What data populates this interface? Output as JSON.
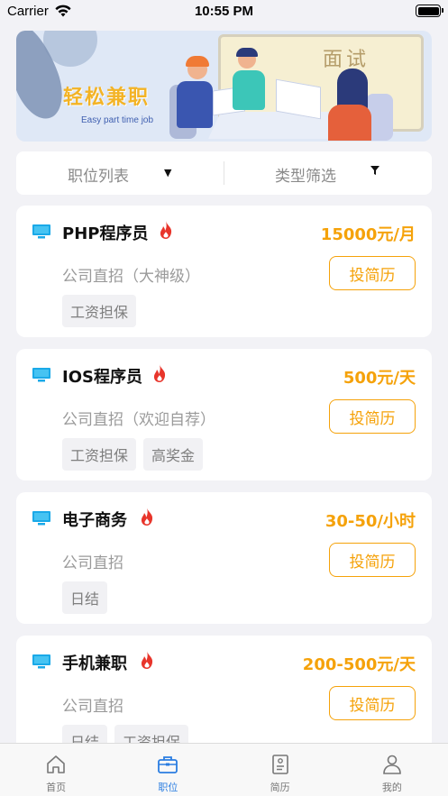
{
  "status_bar": {
    "carrier": "Carrier",
    "time": "10:55 PM"
  },
  "banner": {
    "brand": "轻松兼职",
    "brand_sub": "Easy part time job",
    "board_title": "面试"
  },
  "filters": {
    "left": {
      "label": "职位列表",
      "icon": "triangle-down-icon"
    },
    "right": {
      "label": "类型筛选",
      "icon": "funnel-icon"
    }
  },
  "jobs": [
    {
      "title": "PHP程序员",
      "salary": "15000元/月",
      "company": "公司直招（大神级）",
      "apply_label": "投简历",
      "tags": [
        "工资担保"
      ]
    },
    {
      "title": "IOS程序员",
      "salary": "500元/天",
      "company": "公司直招（欢迎自荐）",
      "apply_label": "投简历",
      "tags": [
        "工资担保",
        "高奖金"
      ]
    },
    {
      "title": "电子商务",
      "salary": "30-50/小时",
      "company": "公司直招",
      "apply_label": "投简历",
      "tags": [
        "日结"
      ]
    },
    {
      "title": "手机兼职",
      "salary": "200-500元/天",
      "company": "公司直招",
      "apply_label": "投简历",
      "tags": [
        "日结",
        "工资担保"
      ]
    }
  ],
  "tabs": [
    {
      "label": "首页",
      "icon": "home-icon",
      "active": false
    },
    {
      "label": "职位",
      "icon": "briefcase-icon",
      "active": true
    },
    {
      "label": "简历",
      "icon": "resume-icon",
      "active": false
    },
    {
      "label": "我的",
      "icon": "user-icon",
      "active": false
    }
  ],
  "colors": {
    "accent": "#f5a20a",
    "active_tab": "#2a7de1",
    "monitor": "#1aa9e8",
    "flame": "#e8352b",
    "background": "#f2f2f6"
  }
}
